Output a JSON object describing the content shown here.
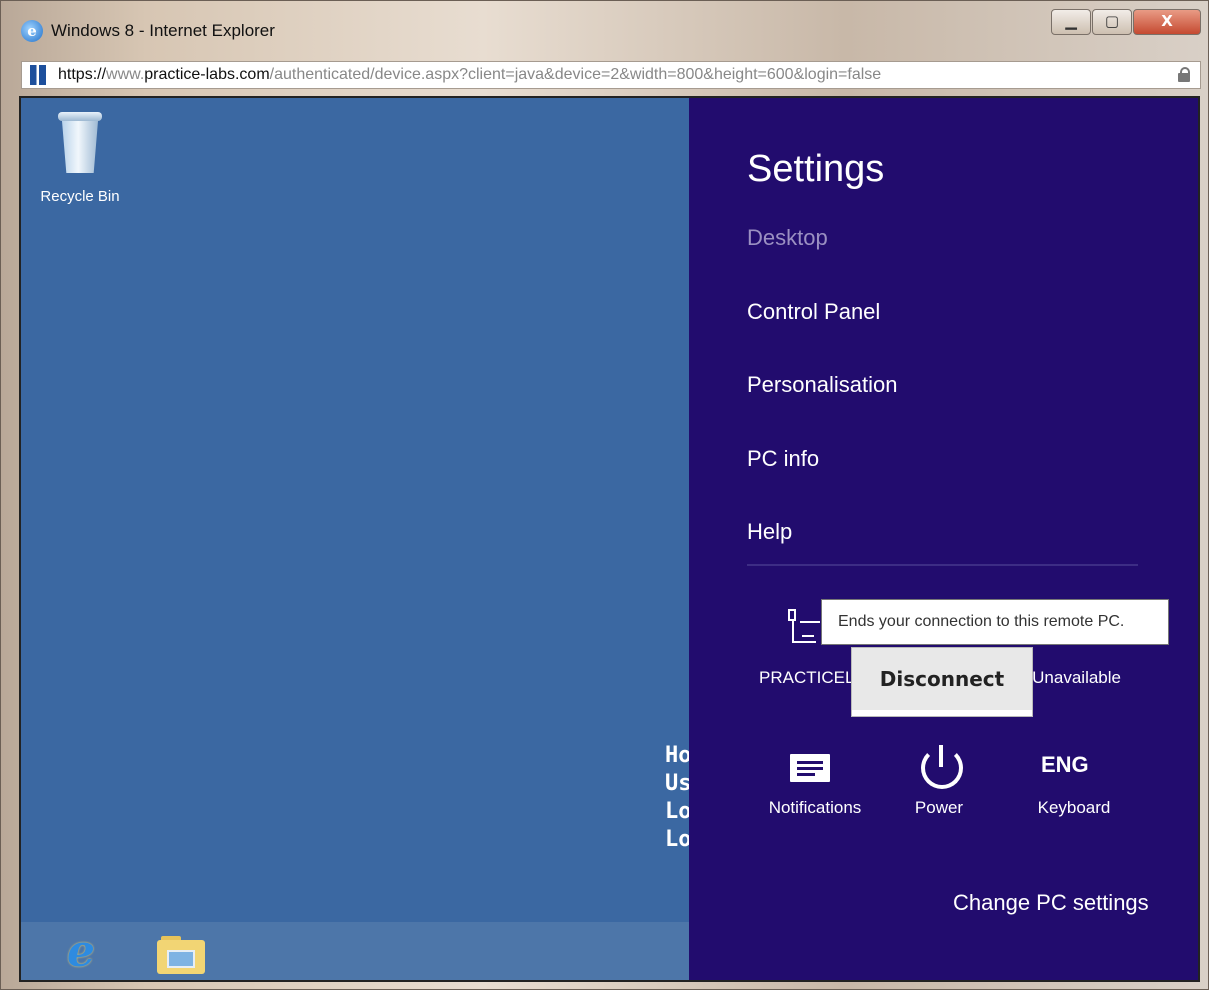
{
  "window": {
    "title": "Windows 8 - Internet Explorer",
    "controls": {
      "minimize": "▁",
      "maximize": "▢",
      "close": "X"
    }
  },
  "address_bar": {
    "url_scheme": "https://",
    "url_host_pre": "www.",
    "url_host": "practice-labs.com",
    "url_path": "/authenticated/device.aspx?client=java&device=2&width=800&height=600&login=false"
  },
  "desktop": {
    "recycle_bin_label": "Recycle Bin",
    "sysinfo_lines": [
      "Ho",
      "Us",
      "Lo",
      "Lo"
    ],
    "taskbar_ie_glyph": "e"
  },
  "settings_charm": {
    "title": "Settings",
    "items": [
      "Desktop",
      "Control Panel",
      "Personalisation",
      "PC info",
      "Help"
    ],
    "quick": {
      "network_label": "PRACTICELABS",
      "unavailable_label": "Unavailable",
      "notifications_label": "Notifications",
      "power_label": "Power",
      "keyboard_glyph": "ENG",
      "keyboard_label": "Keyboard"
    },
    "change_settings": "Change PC settings"
  },
  "popup": {
    "tooltip": "Ends your connection to this remote PC.",
    "disconnect": "Disconnect"
  },
  "colors": {
    "charm_bg": "#220c6e",
    "desktop_bg": "#3b68a2",
    "disabled_item": "#9b90c2"
  }
}
